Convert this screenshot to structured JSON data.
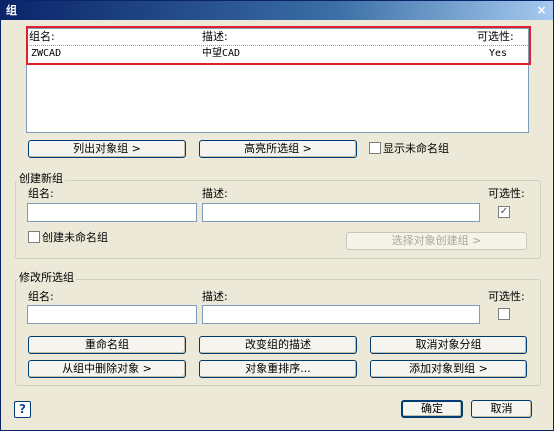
{
  "window": {
    "title": "组",
    "close_glyph": "×"
  },
  "list": {
    "headers": {
      "name": "组名:",
      "desc": "描述:",
      "selectable": "可选性:"
    },
    "rows": [
      {
        "name": "ZWCAD",
        "desc": "中望CAD",
        "selectable": "Yes"
      }
    ]
  },
  "top_buttons": {
    "list_objects": "列出对象组 >",
    "highlight_selected": "高亮所选组 >",
    "show_unnamed": "显示未命名组"
  },
  "create": {
    "title": "创建新组",
    "name_label": "组名:",
    "desc_label": "描述:",
    "selectable_label": "可选性:",
    "name_value": "",
    "desc_value": "",
    "selectable_checked": true,
    "create_unnamed": "创建未命名组",
    "select_objects_button": "选择对象创建组 >"
  },
  "modify": {
    "title": "修改所选组",
    "name_label": "组名:",
    "desc_label": "描述:",
    "selectable_label": "可选性:",
    "name_value": "",
    "desc_value": "",
    "selectable_checked": false,
    "rename": "重命名组",
    "change_desc": "改变组的描述",
    "ungroup": "取消对象分组",
    "remove": "从组中删除对象 >",
    "reorder": "对象重排序...",
    "add": "添加对象到组 >"
  },
  "footer": {
    "help": "?",
    "ok": "确定",
    "cancel": "取消"
  },
  "icons": {
    "close": "close-icon",
    "help": "help-icon",
    "check": "checkmark-icon"
  },
  "colors": {
    "highlight_border": "#e0202a",
    "title_start": "#0a246a",
    "title_end": "#a6caf0"
  }
}
